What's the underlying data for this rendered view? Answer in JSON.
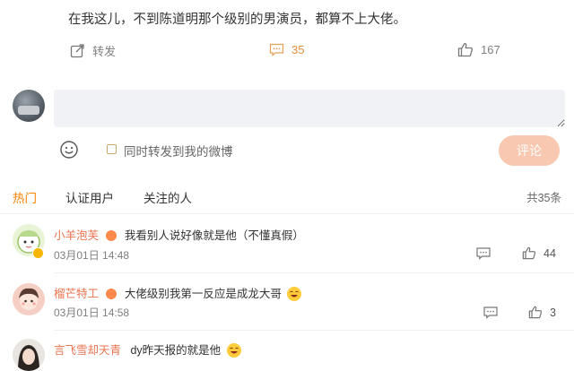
{
  "post": {
    "text": "在我这儿，不到陈道明那个级别的男演员，都算不上大佬。",
    "repost_label": "转发",
    "comments_count": "35",
    "likes_count": "167"
  },
  "composer": {
    "placeholder": "",
    "sync_label": "同时转发到我的微博",
    "submit_label": "评论"
  },
  "tabs": [
    {
      "label": "热门"
    },
    {
      "label": "认证用户"
    },
    {
      "label": "关注的人"
    }
  ],
  "comment_total": "共35条",
  "comments": [
    {
      "name": "小羊泡芙",
      "text": "我看别人说好像就是他（不懂真假）",
      "time": "03月01日 14:48",
      "likes": "44"
    },
    {
      "name": "榴芒特工",
      "text": "大佬级别我第一反应是成龙大哥",
      "time": "03月01日 14:58",
      "likes": "3"
    },
    {
      "name": "言飞雪却天青",
      "text": "dy昨天报的就是他"
    }
  ],
  "colors": {
    "accent": "#ff8200",
    "username": "#eb7350",
    "submit_bg": "#f9c8b0"
  }
}
